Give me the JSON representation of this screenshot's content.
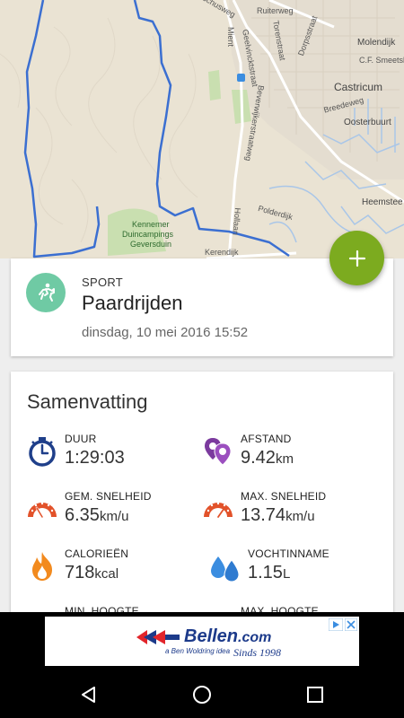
{
  "map": {
    "labels": {
      "ruiterweg": "Ruiterweg",
      "geelvincktstraat": "Geelvincktstraat",
      "torenstraat": "Torenstraat",
      "dorpsstraat": "Dorpsstraat",
      "molendijk": "Molendijk",
      "cf_smeetslaan": "C.F. Smeetslaan",
      "castricum": "Castricum",
      "breedeweg": "Breedeweg",
      "oosterbuurt": "Oosterbuurt",
      "beverwijkerstraatweg": "Beverwijkerstraatweg",
      "heemstede": "Heemstee",
      "polderdijk": "Polderdijk",
      "hollaan": "Hollaan",
      "kennemer": "Kennemer",
      "duincampings": "Duincampings",
      "geversduin": "Geversduin",
      "zeeweg": "Kerendijk",
      "mient": "Mient",
      "schusweg": "schusweg"
    },
    "colors": {
      "route": "#3b6fd1",
      "background": "#eae3d3",
      "water": "#a9c6e8",
      "green": "#c9dfb0"
    }
  },
  "fab": {
    "icon": "plus-icon",
    "color": "#7cab1f"
  },
  "sport": {
    "label": "SPORT",
    "name": "Paardrijden",
    "date": "dinsdag, 10 mei 2016 15:52",
    "icon": "horse-riding-icon",
    "icon_color": "#6fcaa4"
  },
  "summary": {
    "title": "Samenvatting",
    "stats": [
      {
        "label": "DUUR",
        "value": "1:29:03",
        "unit": "",
        "icon": "stopwatch-icon"
      },
      {
        "label": "AFSTAND",
        "value": "9.42",
        "unit": "km",
        "icon": "location-pins-icon"
      },
      {
        "label": "GEM. SNELHEID",
        "value": "6.35",
        "unit": "km/u",
        "icon": "speedometer-icon"
      },
      {
        "label": "MAX. SNELHEID",
        "value": "13.74",
        "unit": "km/u",
        "icon": "speedometer-max-icon"
      },
      {
        "label": "CALORIEËN",
        "value": "718",
        "unit": "kcal",
        "icon": "flame-icon"
      },
      {
        "label": "VOCHTINNAME",
        "value": "1.15",
        "unit": "L",
        "icon": "water-drops-icon"
      },
      {
        "label": "MIN. HOOGTE",
        "value": "",
        "unit": "",
        "icon": ""
      },
      {
        "label": "MAX. HOOGTE",
        "value": "",
        "unit": "",
        "icon": ""
      }
    ]
  },
  "ad": {
    "brand": "Bellen",
    "tld": ".com",
    "tagline": "a Ben Woldring idea",
    "sinds": "Sinds 1998"
  },
  "nav": {
    "back": "back-icon",
    "home": "home-icon",
    "recents": "recents-icon"
  }
}
